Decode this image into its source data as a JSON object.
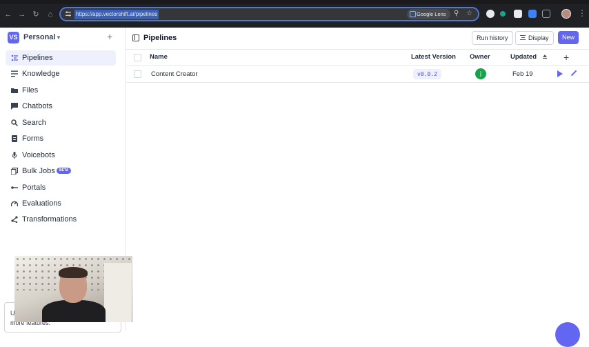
{
  "browser": {
    "url": "https://app.vectorshift.ai/pipelines",
    "lens_label": "Google Lens",
    "profile_color": "#b98a7e"
  },
  "workspace": {
    "badge": "VS",
    "name": "Personal"
  },
  "sidebar": {
    "items": [
      {
        "label": "Pipelines",
        "icon": "pipelines-icon",
        "active": true
      },
      {
        "label": "Knowledge",
        "icon": "knowledge-icon"
      },
      {
        "label": "Files",
        "icon": "folder-icon"
      },
      {
        "label": "Chatbots",
        "icon": "chat-icon"
      },
      {
        "label": "Search",
        "icon": "search-icon"
      },
      {
        "label": "Forms",
        "icon": "form-icon"
      },
      {
        "label": "Voicebots",
        "icon": "microphone-icon"
      },
      {
        "label": "Bulk Jobs",
        "icon": "bulk-jobs-icon",
        "badge": "BETA"
      },
      {
        "label": "Portals",
        "icon": "portal-icon"
      },
      {
        "label": "Evaluations",
        "icon": "evaluations-icon"
      },
      {
        "label": "Transformations",
        "icon": "transform-icon"
      }
    ],
    "upsell_prefix": "U",
    "upsell_text": "more features."
  },
  "main": {
    "title": "Pipelines",
    "run_history_label": "Run history",
    "display_label": "Display",
    "new_label": "New"
  },
  "table": {
    "columns": {
      "name": "Name",
      "latest_version": "Latest Version",
      "owner": "Owner",
      "updated": "Updated"
    },
    "rows": [
      {
        "name": "Content Creator",
        "version": "v0.0.2",
        "owner_initial": "j",
        "updated": "Feb 19"
      }
    ]
  },
  "colors": {
    "accent": "#6366f1",
    "owner_avatar": "#16a34a"
  }
}
